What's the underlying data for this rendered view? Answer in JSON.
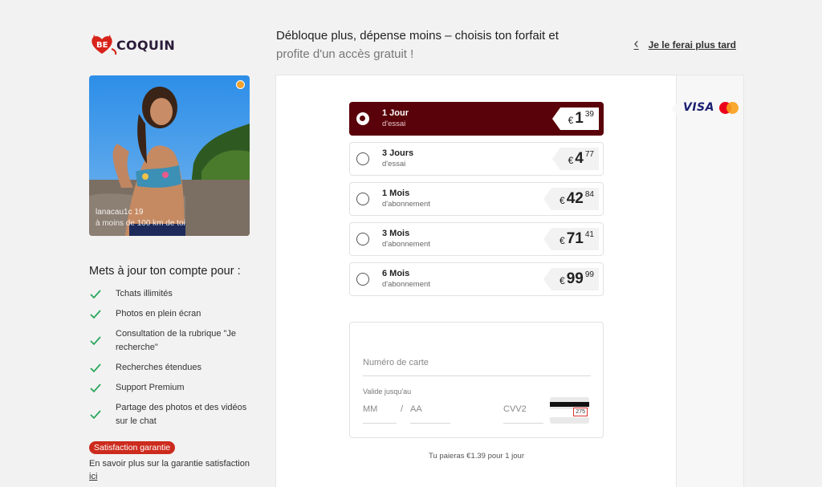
{
  "brand": {
    "logo_text": "COQUIN",
    "logo_heart_text": "BE"
  },
  "header": {
    "headline": "Débloque plus, dépense moins – choisis ton forfait et",
    "subline": "profite d'un accès gratuit !",
    "later_link": "Je le ferai plus tard"
  },
  "profile": {
    "name": "lanacau1c 19",
    "distance": "à moins de 100 km de toi"
  },
  "benefits": {
    "title": "Mets à jour ton compte pour :",
    "items": [
      "Tchats illimités",
      "Photos en plein écran",
      "Consultation de la rubrique \"Je recherche\"",
      "Recherches étendues",
      "Support Premium",
      "Partage des photos et des vidéos sur le chat"
    ],
    "badge": "Satisfaction garantie",
    "guarantee_text": "En savoir plus sur la garantie satisfaction",
    "guarantee_link": "ici"
  },
  "payment": {
    "visa_label": "VISA",
    "mastercard_icon": "mastercard-icon"
  },
  "plans": [
    {
      "name": "1 Jour",
      "type": "d'essai",
      "currency": "€",
      "int": "1",
      "dec": "39",
      "selected": true
    },
    {
      "name": "3 Jours",
      "type": "d'essai",
      "currency": "€",
      "int": "4",
      "dec": "77",
      "selected": false
    },
    {
      "name": "1 Mois",
      "type": "d'abonnement",
      "currency": "€",
      "int": "42",
      "dec": "84",
      "selected": false
    },
    {
      "name": "3 Mois",
      "type": "d'abonnement",
      "currency": "€",
      "int": "71",
      "dec": "41",
      "selected": false
    },
    {
      "name": "6 Mois",
      "type": "d'abonnement",
      "currency": "€",
      "int": "99",
      "dec": "99",
      "selected": false
    }
  ],
  "card_form": {
    "card_number_placeholder": "Numéro de carte",
    "expiry_label": "Valide jusqu'au",
    "mm_placeholder": "MM",
    "separator": "/",
    "aa_placeholder": "AA",
    "cvv_placeholder": "CVV2",
    "cvv_example": "275"
  },
  "total_text": "Tu paieras €1.39 pour 1 jour",
  "colors": {
    "selected_plan": "#5a020a",
    "badge": "#cc2b1d",
    "check": "#2aa65a",
    "online": "#f2a12a"
  }
}
